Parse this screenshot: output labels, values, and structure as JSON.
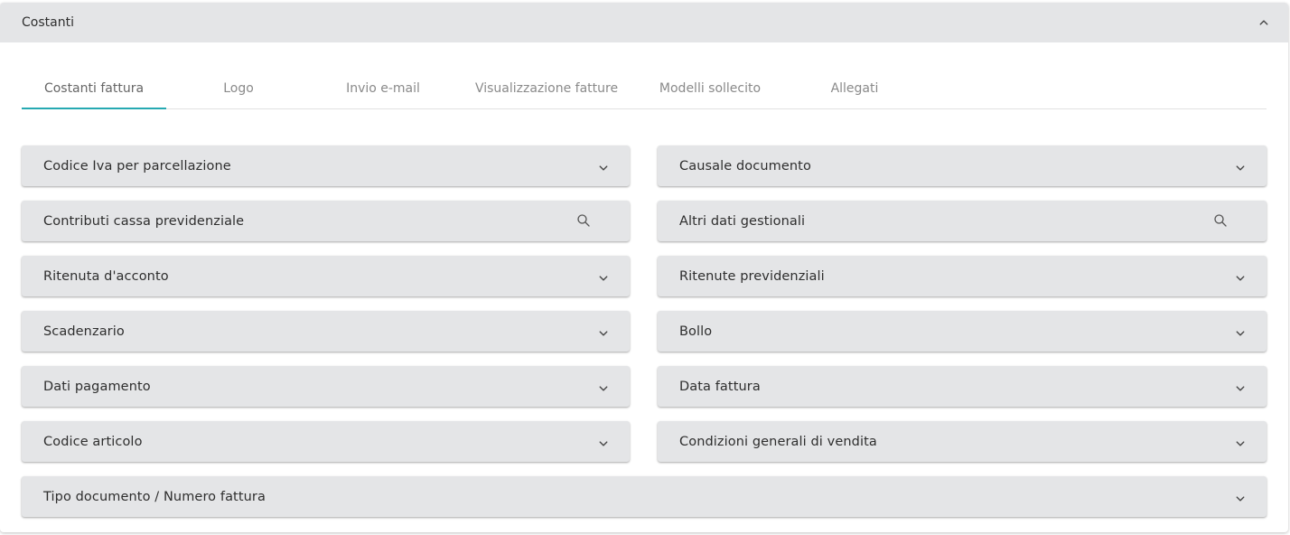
{
  "panel": {
    "title": "Costanti"
  },
  "tabs": [
    {
      "label": "Costanti fattura",
      "active": true
    },
    {
      "label": "Logo",
      "active": false
    },
    {
      "label": "Invio e-mail",
      "active": false
    },
    {
      "label": "Visualizzazione fatture",
      "active": false
    },
    {
      "label": "Modelli sollecito",
      "active": false
    },
    {
      "label": "Allegati",
      "active": false
    }
  ],
  "sections": {
    "left": [
      {
        "label": "Codice Iva per parcellazione",
        "icon": "chevron-down-icon"
      },
      {
        "label": "Contributi cassa previdenziale",
        "icon": "search-icon"
      },
      {
        "label": "Ritenuta d'acconto",
        "icon": "chevron-down-icon"
      },
      {
        "label": "Scadenzario",
        "icon": "chevron-down-icon"
      },
      {
        "label": "Dati pagamento",
        "icon": "chevron-down-icon"
      },
      {
        "label": "Codice articolo",
        "icon": "chevron-down-icon"
      }
    ],
    "right": [
      {
        "label": "Causale documento",
        "icon": "chevron-down-icon"
      },
      {
        "label": "Altri dati gestionali",
        "icon": "search-icon"
      },
      {
        "label": "Ritenute previdenziali",
        "icon": "chevron-down-icon"
      },
      {
        "label": "Bollo",
        "icon": "chevron-down-icon"
      },
      {
        "label": "Data fattura",
        "icon": "chevron-down-icon"
      },
      {
        "label": "Condizioni generali di vendita",
        "icon": "chevron-down-icon"
      }
    ],
    "full": {
      "label": "Tipo documento / Numero fattura",
      "icon": "chevron-down-icon"
    }
  },
  "colors": {
    "accent": "#26a9b2",
    "row_background": "#e4e5e7"
  }
}
